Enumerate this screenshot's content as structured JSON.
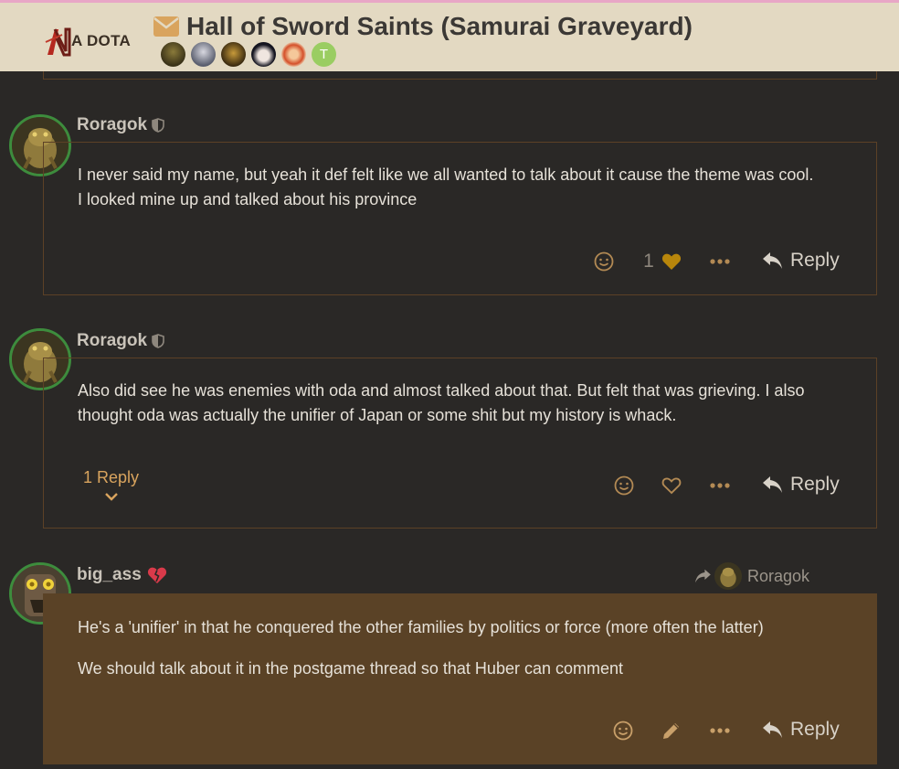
{
  "header": {
    "logo_text": "A DOTA",
    "topic_title": "Hall of Sword Saints (Samurai Graveyard)",
    "participants_extra_initial": "T"
  },
  "posts": [
    {
      "username": "Roragok",
      "text_lines": [
        "I never said my name, but yeah it def felt like we all wanted to talk about it cause the theme was cool.",
        "I looked mine up and talked about his province"
      ],
      "like_count": "1",
      "reply_label": "Reply"
    },
    {
      "username": "Roragok",
      "text_lines": [
        "Also did see he was enemies with oda and almost talked about that. But felt that was grieving. I also",
        "thought oda was actually the unifier of Japan or some shit but my history is whack."
      ],
      "replies_label": "1 Reply",
      "reply_label": "Reply"
    },
    {
      "username": "big_ass",
      "reply_to": "Roragok",
      "paragraphs": [
        "He's a 'unifier' in that he conquered the other families by politics or force (more often the latter)",
        "We should talk about it in the postgame thread so that Huber can comment"
      ],
      "reply_label": "Reply"
    }
  ],
  "colors": {
    "header_bg": "#e3d9c2",
    "page_bg": "#2a2826",
    "accent": "#d9a45e",
    "liked_heart": "#b8860b",
    "highlight_bg": "#5a4226"
  }
}
